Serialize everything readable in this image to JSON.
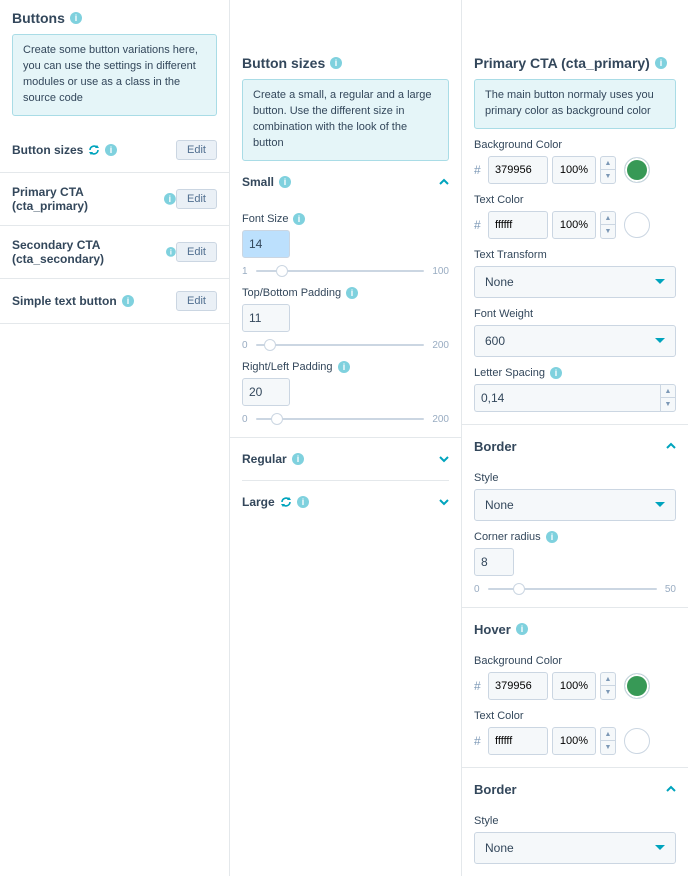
{
  "panel1": {
    "title": "Buttons",
    "notice": "Create some button variations here, you can use the settings in different modules or use as a class in the source code",
    "items": [
      {
        "label": "Button sizes",
        "edit": "Edit",
        "sync": true
      },
      {
        "label": "Primary CTA (cta_primary)",
        "edit": "Edit",
        "sync": false
      },
      {
        "label": "Secondary CTA (cta_secondary)",
        "edit": "Edit",
        "sync": false
      },
      {
        "label": "Simple text button",
        "edit": "Edit",
        "sync": false
      }
    ]
  },
  "panel2": {
    "title": "Button sizes",
    "notice": "Create a small, a regular and a large button. Use the different size in combination with the look of the button",
    "small": {
      "title": "Small",
      "font_size_label": "Font Size",
      "font_size_value": "14",
      "font_size_min": "1",
      "font_size_max": "100",
      "tb_padding_label": "Top/Bottom Padding",
      "tb_padding_value": "11",
      "tb_min": "0",
      "tb_max": "200",
      "rl_padding_label": "Right/Left Padding",
      "rl_padding_value": "20",
      "rl_min": "0",
      "rl_max": "200"
    },
    "regular": {
      "title": "Regular"
    },
    "large": {
      "title": "Large"
    }
  },
  "panel3": {
    "title": "Primary CTA (cta_primary)",
    "notice": "The main button normaly uses you primary color as background color",
    "bg_label": "Background Color",
    "text_label": "Text Color",
    "bg_hex": "379956",
    "bg_pct": "100%",
    "bg_swatch": "#379956",
    "txt_hex": "ffffff",
    "txt_pct": "100%",
    "txt_swatch": "#ffffff",
    "tt_label": "Text Transform",
    "tt_value": "None",
    "fw_label": "Font Weight",
    "fw_value": "600",
    "ls_label": "Letter Spacing",
    "ls_value": "0,14",
    "border": {
      "title": "Border",
      "style_label": "Style",
      "style_value": "None",
      "radius_label": "Corner radius",
      "radius_value": "8",
      "radius_min": "0",
      "radius_max": "50"
    },
    "hover": {
      "title": "Hover",
      "bg_label": "Background Color",
      "bg_hex": "379956",
      "bg_pct": "100%",
      "bg_swatch": "#379956",
      "txt_label": "Text Color",
      "txt_hex": "ffffff",
      "txt_pct": "100%",
      "txt_swatch": "#ffffff"
    },
    "border2": {
      "title": "Border",
      "style_label": "Style",
      "style_value": "None"
    }
  }
}
